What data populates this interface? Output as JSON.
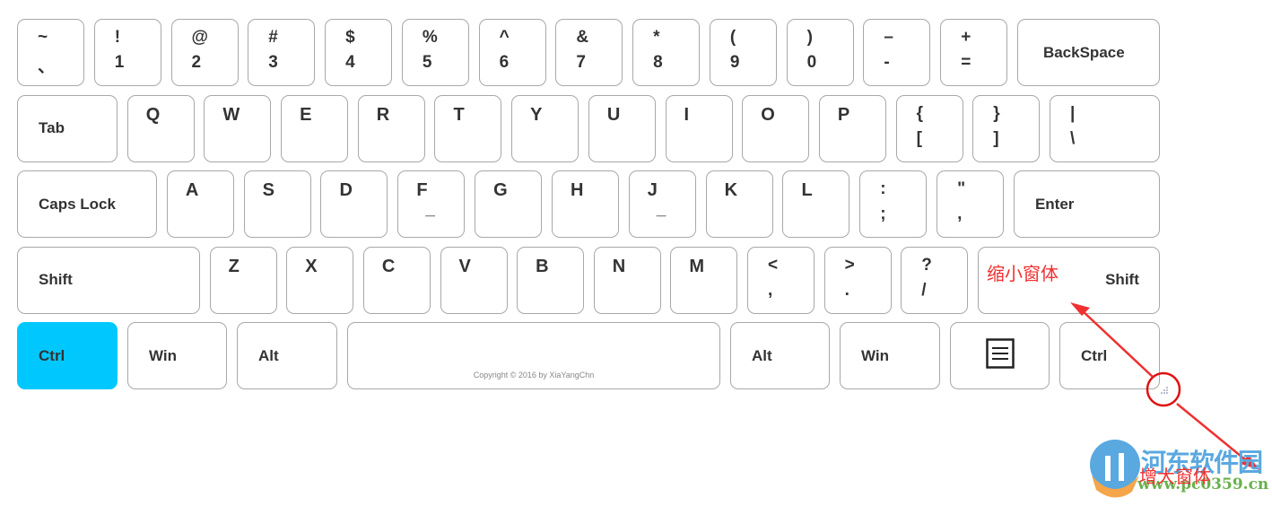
{
  "rows": [
    [
      {
        "top": "~",
        "bot": "、",
        "w": 75
      },
      {
        "top": "!",
        "bot": "1",
        "w": 75
      },
      {
        "top": "@",
        "bot": "2",
        "w": 75
      },
      {
        "top": "#",
        "bot": "3",
        "w": 75
      },
      {
        "top": "$",
        "bot": "4",
        "w": 75
      },
      {
        "top": "%",
        "bot": "5",
        "w": 75
      },
      {
        "top": "^",
        "bot": "6",
        "w": 75
      },
      {
        "top": "&",
        "bot": "7",
        "w": 75
      },
      {
        "top": "*",
        "bot": "8",
        "w": 75
      },
      {
        "top": "(",
        "bot": "9",
        "w": 75
      },
      {
        "top": ")",
        "bot": "0",
        "w": 75
      },
      {
        "top": "–",
        "bot": "-",
        "w": 75
      },
      {
        "top": "+",
        "bot": "=",
        "w": 75
      },
      {
        "mod": "BackSpace",
        "w": 159,
        "center": true
      }
    ],
    [
      {
        "mod": "Tab",
        "w": 112
      },
      {
        "letter": "Q"
      },
      {
        "letter": "W"
      },
      {
        "letter": "E"
      },
      {
        "letter": "R"
      },
      {
        "letter": "T"
      },
      {
        "letter": "Y"
      },
      {
        "letter": "U"
      },
      {
        "letter": "I"
      },
      {
        "letter": "O"
      },
      {
        "letter": "P"
      },
      {
        "top": "{",
        "bot": "["
      },
      {
        "top": "}",
        "bot": "]"
      },
      {
        "top": "|",
        "bot": "\\",
        "w": 123
      }
    ],
    [
      {
        "mod": "Caps Lock",
        "w": 156
      },
      {
        "letter": "A"
      },
      {
        "letter": "S"
      },
      {
        "letter": "D"
      },
      {
        "letter": "F",
        "bot": "_"
      },
      {
        "letter": "G"
      },
      {
        "letter": "H"
      },
      {
        "letter": "J",
        "bot": "_"
      },
      {
        "letter": "K"
      },
      {
        "letter": "L"
      },
      {
        "top": ":",
        "bot": ";"
      },
      {
        "top": "\"",
        "bot": ","
      },
      {
        "mod": "Enter",
        "w": 163
      }
    ],
    [
      {
        "mod": "Shift",
        "w": 204
      },
      {
        "letter": "Z"
      },
      {
        "letter": "X"
      },
      {
        "letter": "C"
      },
      {
        "letter": "V"
      },
      {
        "letter": "B"
      },
      {
        "letter": "N"
      },
      {
        "letter": "M"
      },
      {
        "top": "<",
        "bot": ","
      },
      {
        "top": ">",
        "bot": "."
      },
      {
        "top": "?",
        "bot": "/"
      },
      {
        "mod": "Shift",
        "w": 203,
        "right": true
      }
    ],
    [
      {
        "mod": "Ctrl",
        "w": 112,
        "active": true
      },
      {
        "mod": "Win",
        "w": 111
      },
      {
        "mod": "Alt",
        "w": 112
      },
      {
        "space": true,
        "w": 416,
        "copyright": "Copyright ©  2016 by XiaYangChn"
      },
      {
        "mod": "Alt",
        "w": 111
      },
      {
        "mod": "Win",
        "w": 112
      },
      {
        "menu": true,
        "w": 111
      },
      {
        "mod": "Ctrl",
        "w": 112
      }
    ]
  ],
  "annotations": {
    "shrink": "缩小窗体",
    "enlarge": "增大窗体",
    "color": "#f03030"
  },
  "accent": "#00c8ff",
  "watermark": {
    "name": "河东软件园",
    "url": "www.pc0359.cn"
  }
}
